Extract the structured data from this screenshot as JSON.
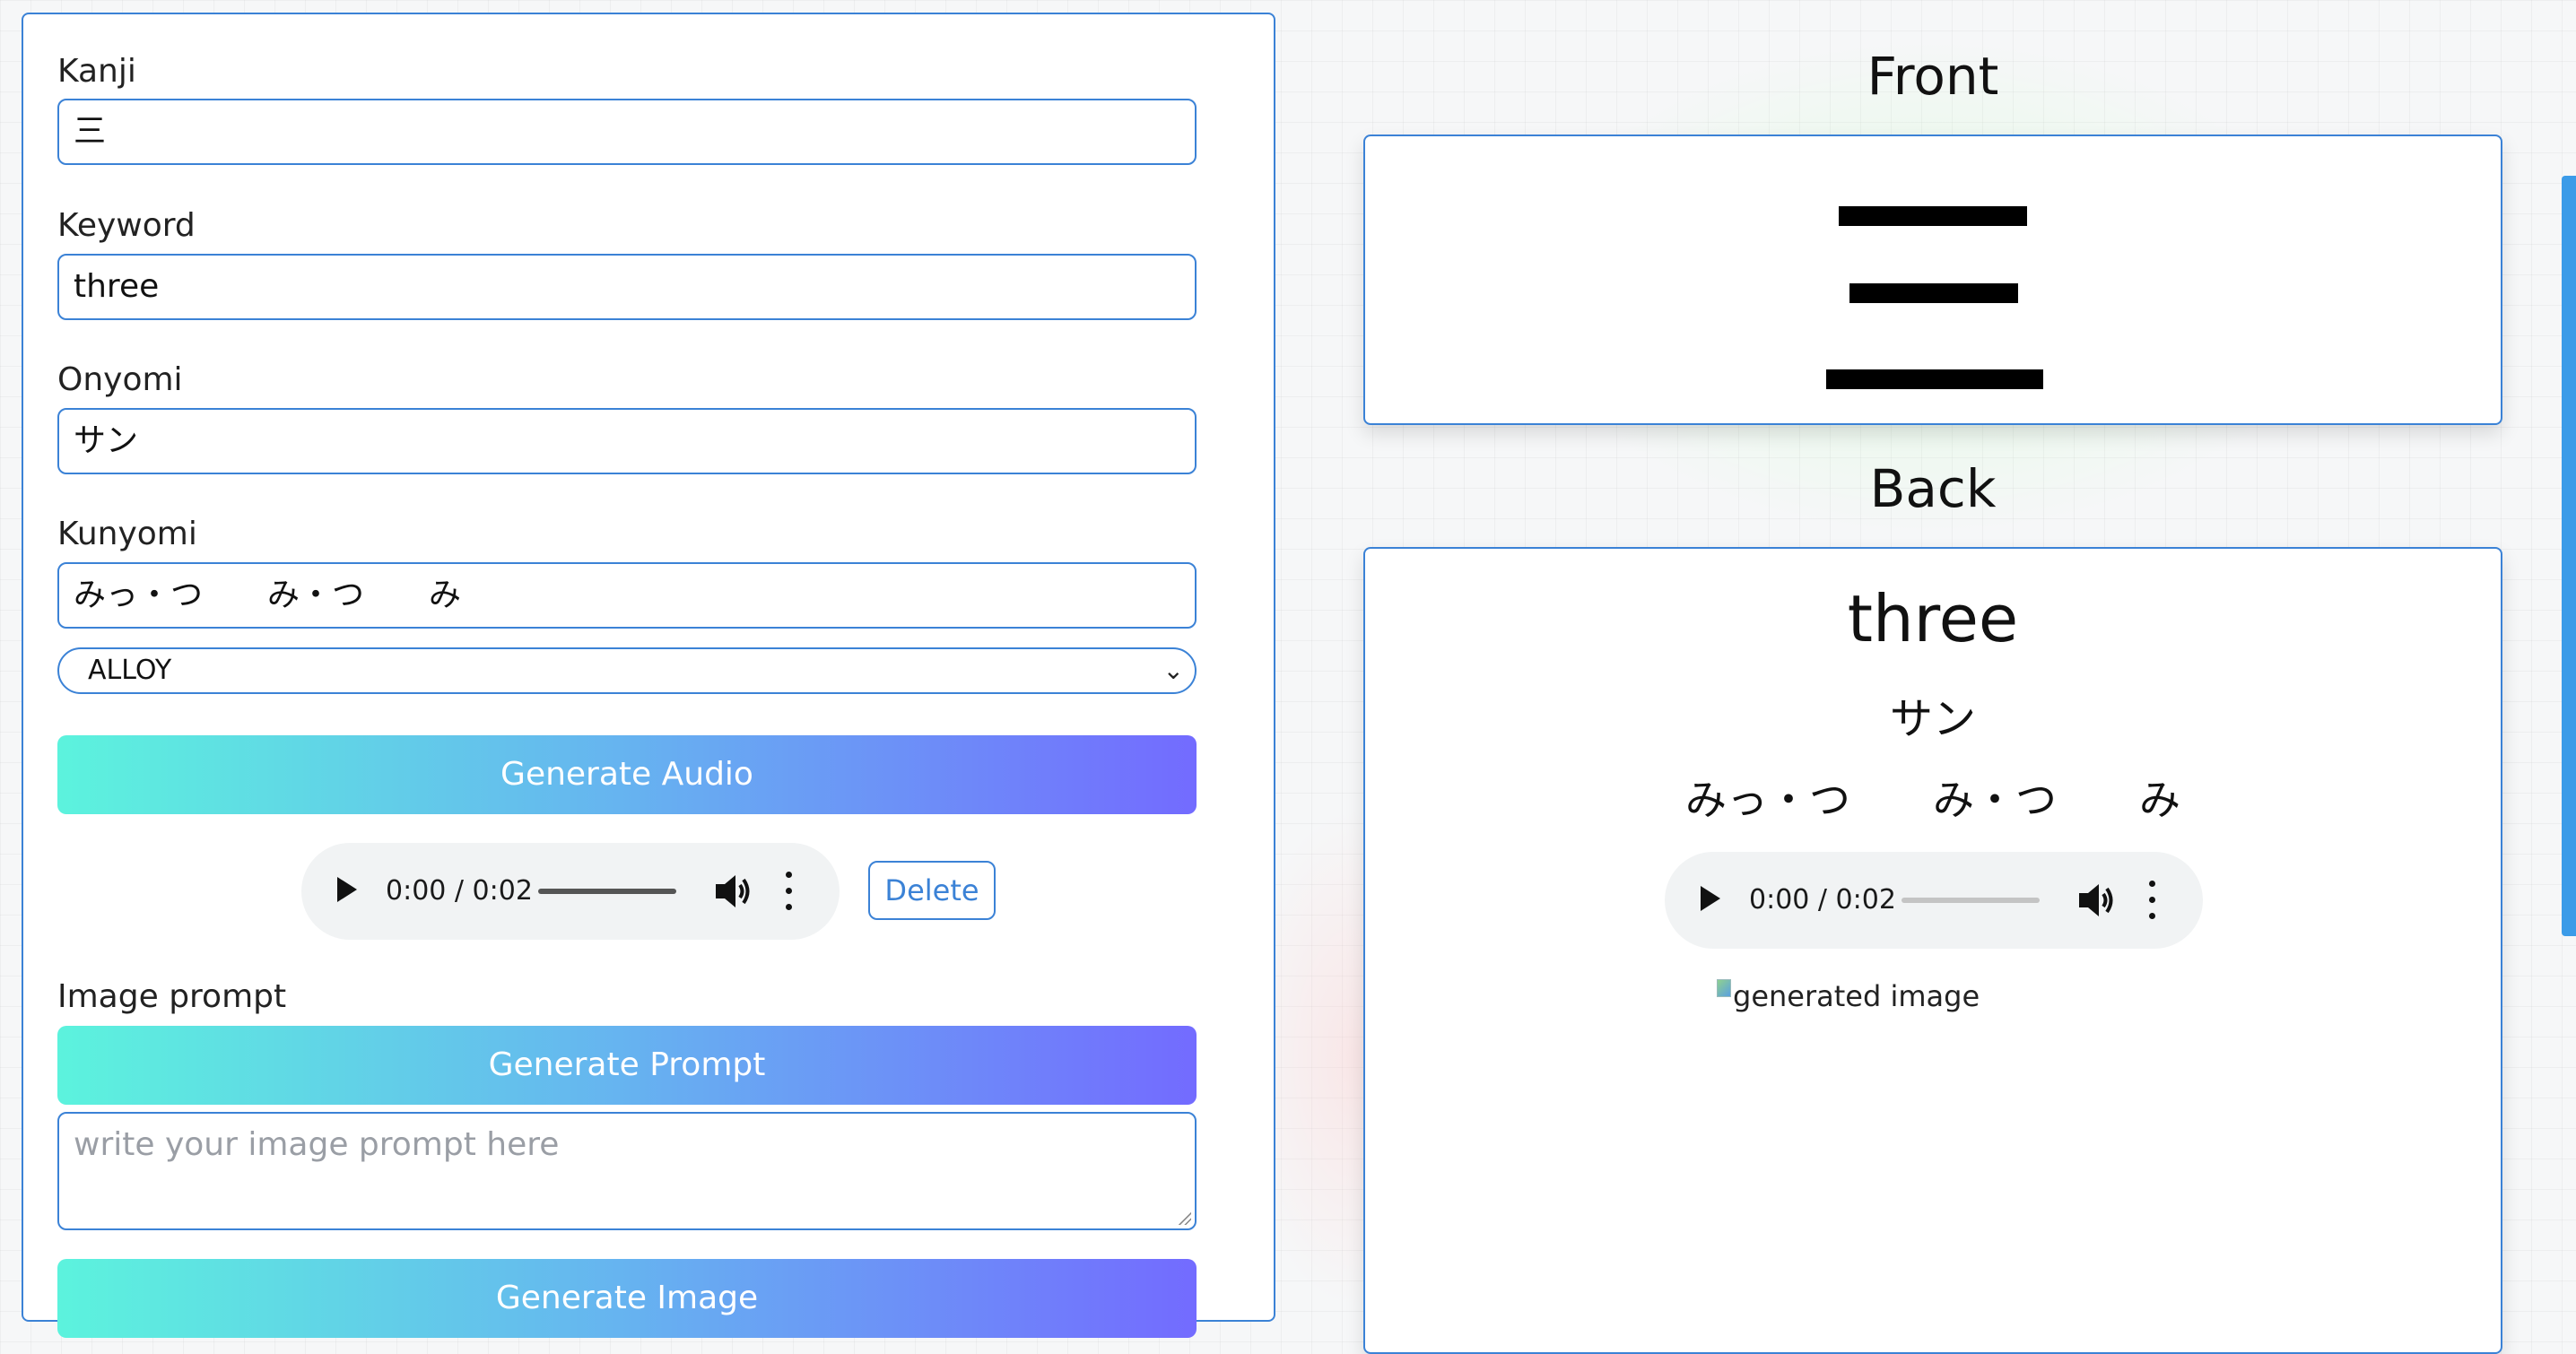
{
  "form": {
    "kanji": {
      "label": "Kanji",
      "value": "三"
    },
    "keyword": {
      "label": "Keyword",
      "value": "three"
    },
    "onyomi": {
      "label": "Onyomi",
      "value": "サン"
    },
    "kunyomi": {
      "label": "Kunyomi",
      "value": "みっ・つ　　み・つ　　み"
    },
    "voice_select": {
      "selected": "ALLOY"
    },
    "generate_audio_label": "Generate Audio",
    "audio": {
      "time": "0:00 / 0:02"
    },
    "delete_label": "Delete",
    "image_prompt_label": "Image prompt",
    "generate_prompt_label": "Generate Prompt",
    "prompt_placeholder": "write your image prompt here",
    "generate_image_label": "Generate Image"
  },
  "preview": {
    "front_heading": "Front",
    "back_heading": "Back",
    "front_kanji": "三",
    "back": {
      "keyword": "three",
      "onyomi": "サン",
      "kunyomi": "みっ・つ　　み・つ　　み",
      "audio_time": "0:00 / 0:02",
      "image_alt": "generated image"
    }
  },
  "colors": {
    "accent": "#3b82d6",
    "gradient_start": "#5cf3dd",
    "gradient_end": "#736bff"
  }
}
